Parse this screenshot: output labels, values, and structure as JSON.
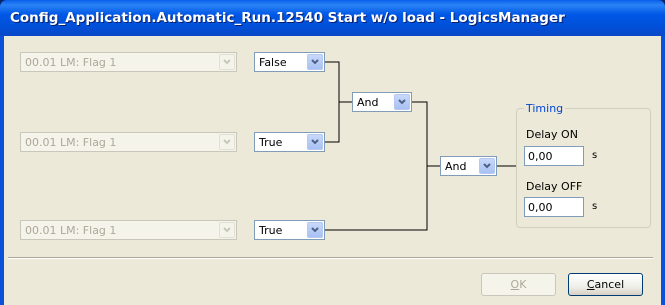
{
  "window": {
    "title": "Config_Application.Automatic_Run.12540 Start w/o load - LogicsManager"
  },
  "inputs": [
    {
      "source": "00.01 LM: Flag 1",
      "operator": "False"
    },
    {
      "source": "00.01 LM: Flag 1",
      "operator": "True"
    },
    {
      "source": "00.01 LM: Flag 1",
      "operator": "True"
    }
  ],
  "gates": {
    "gate1": "And",
    "gate2": "And"
  },
  "timing": {
    "title": "Timing",
    "delay_on_label": "Delay ON",
    "delay_on_value": "0,00",
    "delay_off_label": "Delay OFF",
    "delay_off_value": "0,00",
    "unit": "s"
  },
  "buttons": {
    "ok_mnemonic": "O",
    "ok_rest": "K",
    "cancel_mnemonic": "C",
    "cancel_rest": "ancel"
  },
  "icons": {
    "dropdown": "chevron-down-icon"
  },
  "colors": {
    "titlebar": "#0058E6",
    "timing_title": "#0046D5",
    "client": "#ECE9D8"
  }
}
